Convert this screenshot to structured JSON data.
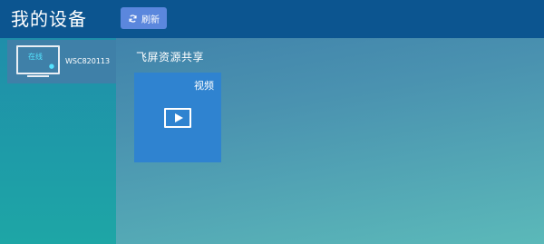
{
  "header": {
    "title": "我的设备",
    "refresh_label": "刷新"
  },
  "sidebar": {
    "devices": [
      {
        "name": "WSC820113",
        "status": "在线",
        "indicator": "●",
        "icon": "monitor-icon"
      }
    ]
  },
  "main": {
    "section_title": "飞屏资源共享",
    "tiles": [
      {
        "label": "视频",
        "icon": "play-video-icon"
      }
    ]
  },
  "colors": {
    "header_bg": "#0c5590",
    "refresh_button": "#5b87dd",
    "tile_bg": "#2f83d0",
    "status_online": "#54e3ff"
  }
}
